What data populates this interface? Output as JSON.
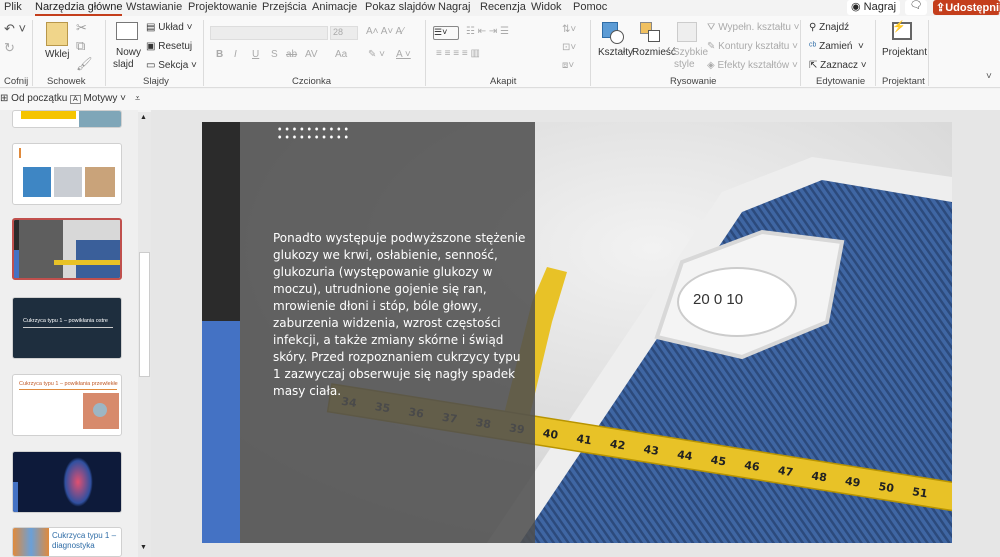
{
  "menu": {
    "tabs": [
      "Plik",
      "Narzędzia główne",
      "Wstawianie",
      "Projektowanie",
      "Przejścia",
      "Animacje",
      "Pokaz slajdów",
      "Nagraj",
      "Recenzja",
      "Widok",
      "Pomoc"
    ],
    "record": "Nagraj",
    "share": "Udostępnij"
  },
  "ribbon": {
    "undo_group": "Cofnij",
    "clipboard": {
      "group": "Schowek",
      "paste": "Wklej"
    },
    "slides": {
      "group": "Slajdy",
      "new_slide_1": "Nowy",
      "new_slide_2": "slajd",
      "layout": "Układ",
      "reset": "Resetuj",
      "section": "Sekcja"
    },
    "font": {
      "group": "Czcionka",
      "size": "28",
      "bold": "B",
      "italic": "I",
      "underline": "U",
      "shadow": "S",
      "strike": "ab",
      "spacing": "AV",
      "case": "Aa"
    },
    "paragraph": {
      "group": "Akapit"
    },
    "drawing": {
      "group": "Rysowanie",
      "shapes": "Kształty",
      "arrange": "Rozmieść",
      "quick_styles_1": "Szybkie",
      "quick_styles_2": "style",
      "fill": "Wypełn. kształtu",
      "outline": "Kontury kształtu",
      "effects": "Efekty kształtów"
    },
    "editing": {
      "group": "Edytowanie",
      "find": "Znajdź",
      "replace": "Zamień",
      "select": "Zaznacz"
    },
    "designer": {
      "group": "Projektant",
      "button": "Projektant"
    }
  },
  "quick": {
    "from_start": "Od początku",
    "themes": "Motywy"
  },
  "thumbnails": [
    {
      "title": ""
    },
    {
      "title": ""
    },
    {
      "title": "",
      "selected": true
    },
    {
      "title": "Cukrzyca typu 1 – powikłania ostre"
    },
    {
      "title": "Cukrzyca typu 1 – powikłania przewlekłe"
    },
    {
      "title": ""
    },
    {
      "title": "Cukrzyca typu 1 – diagnostyka"
    }
  ],
  "slide": {
    "body": "Ponadto występuje podwyższone stężenie glukozy we krwi, osłabienie, senność, glukozuria (występowanie glukozy w moczu), utrudnione gojenie się ran, mrowienie dłoni i stóp, bóle głowy, zaburzenia widzenia, wzrost częstości infekcji, a także zmiany skórne i świąd skóry. Przed rozpoznaniem cukrzycy typu 1 zazwyczaj obserwuje się nagły spadek masy ciała.",
    "tape_numbers": [
      "34",
      "35",
      "36",
      "37",
      "38",
      "39",
      "40",
      "41",
      "42",
      "43",
      "44",
      "45",
      "46",
      "47",
      "48",
      "49",
      "50",
      "51"
    ],
    "scale_numbers": [
      "0",
      "10",
      "20"
    ]
  },
  "colors": {
    "accent": "#c43e1c",
    "slide_blue": "#4472c4",
    "scale_blue": "#3a5f9a",
    "tape": "#e8c227"
  }
}
